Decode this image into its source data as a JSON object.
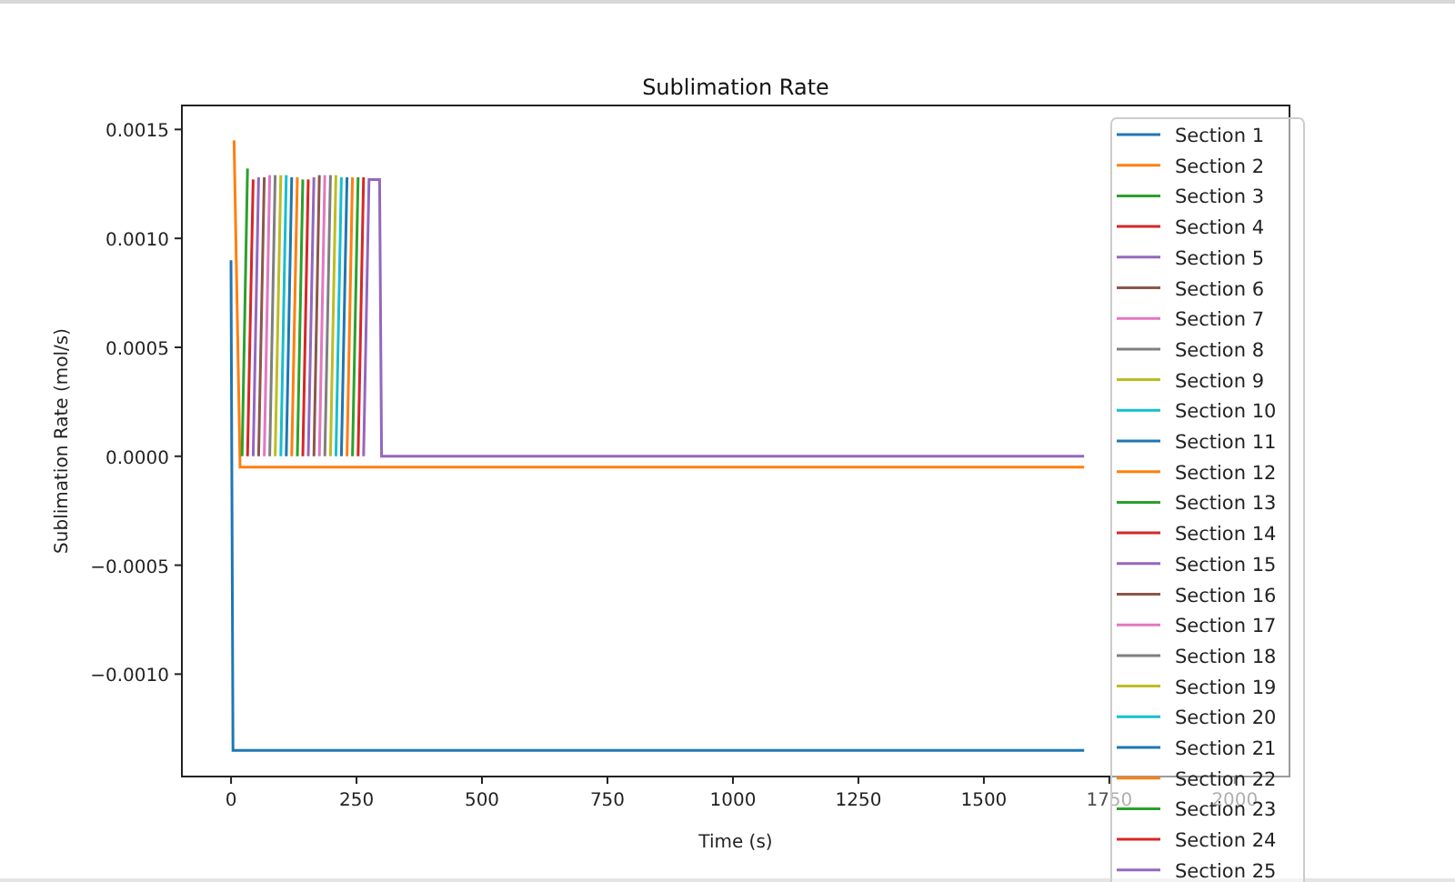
{
  "chart": {
    "chart_data": {
      "type": "line",
      "title": "Sublimation Rate",
      "xlabel": "Time (s)",
      "ylabel": "Sublimation Rate (mol/s)",
      "legend": "right",
      "xlim": [
        -98,
        2109
      ],
      "ylim": [
        -0.00147,
        0.00161
      ],
      "xticks": [
        0,
        250,
        500,
        750,
        1000,
        1250,
        1500,
        1750,
        2000
      ],
      "yticks": [
        {
          "value": 0.0015,
          "label": "0.0015"
        },
        {
          "value": 0.001,
          "label": "0.0010"
        },
        {
          "value": 0.0005,
          "label": "0.0005"
        },
        {
          "value": 0,
          "label": "0.0000"
        },
        {
          "value": -0.0005,
          "label": "−0.0005"
        },
        {
          "value": -0.001,
          "label": "−0.0010"
        }
      ],
      "x": [
        0,
        4,
        6,
        18,
        22,
        33,
        44,
        55,
        66,
        77,
        88,
        99,
        110,
        121,
        132,
        143,
        154,
        165,
        176,
        187,
        198,
        209,
        220,
        231,
        242,
        253,
        264,
        275,
        296,
        300,
        1700
      ],
      "series": [
        {
          "name": "Section 1",
          "color": "#1f77b4",
          "values": [
            0.0009,
            -0.00135,
            -0.00135,
            -0.00135,
            -0.00135,
            -0.00135,
            -0.00135,
            -0.00135,
            -0.00135,
            -0.00135,
            -0.00135,
            -0.00135,
            -0.00135,
            -0.00135,
            -0.00135,
            -0.00135,
            -0.00135,
            -0.00135,
            -0.00135,
            -0.00135,
            -0.00135,
            -0.00135,
            -0.00135,
            -0.00135,
            -0.00135,
            -0.00135,
            -0.00135,
            -0.00135,
            -0.00135,
            -0.00135,
            -0.00135
          ]
        },
        {
          "name": "Section 2",
          "color": "#ff7f0e",
          "values": [
            null,
            null,
            0.00145,
            -5e-05,
            -5e-05,
            -5e-05,
            -5e-05,
            -5e-05,
            -5e-05,
            -5e-05,
            -5e-05,
            -5e-05,
            -5e-05,
            -5e-05,
            -5e-05,
            -5e-05,
            -5e-05,
            -5e-05,
            -5e-05,
            -5e-05,
            -5e-05,
            -5e-05,
            -5e-05,
            -5e-05,
            -5e-05,
            -5e-05,
            -5e-05,
            -5e-05,
            -5e-05,
            -5e-05,
            -5e-05
          ]
        },
        {
          "name": "Section 3",
          "color": "#2ca02c",
          "values": [
            null,
            null,
            null,
            null,
            0,
            0.00132,
            null,
            null,
            null,
            null,
            null,
            null,
            null,
            null,
            null,
            null,
            null,
            null,
            null,
            null,
            null,
            null,
            null,
            null,
            null,
            null,
            null,
            null,
            null,
            null,
            null
          ]
        },
        {
          "name": "Section 4",
          "color": "#d62728",
          "values": [
            null,
            null,
            null,
            null,
            null,
            0,
            0.00127,
            null,
            null,
            null,
            null,
            null,
            null,
            null,
            null,
            null,
            null,
            null,
            null,
            null,
            null,
            null,
            null,
            null,
            null,
            null,
            null,
            null,
            null,
            null,
            null
          ]
        },
        {
          "name": "Section 5",
          "color": "#9467bd",
          "values": [
            null,
            null,
            null,
            null,
            null,
            null,
            0,
            0.00128,
            null,
            null,
            null,
            null,
            null,
            null,
            null,
            null,
            null,
            null,
            null,
            null,
            null,
            null,
            null,
            null,
            null,
            null,
            null,
            null,
            null,
            null,
            null
          ]
        },
        {
          "name": "Section 6",
          "color": "#8c564b",
          "values": [
            null,
            null,
            null,
            null,
            null,
            null,
            null,
            0,
            0.00128,
            null,
            null,
            null,
            null,
            null,
            null,
            null,
            null,
            null,
            null,
            null,
            null,
            null,
            null,
            null,
            null,
            null,
            null,
            null,
            null,
            null,
            null
          ]
        },
        {
          "name": "Section 7",
          "color": "#e377c2",
          "values": [
            null,
            null,
            null,
            null,
            null,
            null,
            null,
            null,
            0,
            0.00129,
            null,
            null,
            null,
            null,
            null,
            null,
            null,
            null,
            null,
            null,
            null,
            null,
            null,
            null,
            null,
            null,
            null,
            null,
            null,
            null,
            null
          ]
        },
        {
          "name": "Section 8",
          "color": "#7f7f7f",
          "values": [
            null,
            null,
            null,
            null,
            null,
            null,
            null,
            null,
            null,
            0,
            0.00129,
            null,
            null,
            null,
            null,
            null,
            null,
            null,
            null,
            null,
            null,
            null,
            null,
            null,
            null,
            null,
            null,
            null,
            null,
            null,
            null
          ]
        },
        {
          "name": "Section 9",
          "color": "#bcbd22",
          "values": [
            null,
            null,
            null,
            null,
            null,
            null,
            null,
            null,
            null,
            null,
            0,
            0.00129,
            null,
            null,
            null,
            null,
            null,
            null,
            null,
            null,
            null,
            null,
            null,
            null,
            null,
            null,
            null,
            null,
            null,
            null,
            null
          ]
        },
        {
          "name": "Section 10",
          "color": "#17becf",
          "values": [
            null,
            null,
            null,
            null,
            null,
            null,
            null,
            null,
            null,
            null,
            null,
            0,
            0.00129,
            null,
            null,
            null,
            null,
            null,
            null,
            null,
            null,
            null,
            null,
            null,
            null,
            null,
            null,
            null,
            null,
            null,
            null
          ]
        },
        {
          "name": "Section 11",
          "color": "#1f77b4",
          "values": [
            null,
            null,
            null,
            null,
            null,
            null,
            null,
            null,
            null,
            null,
            null,
            null,
            0,
            0.00128,
            null,
            null,
            null,
            null,
            null,
            null,
            null,
            null,
            null,
            null,
            null,
            null,
            null,
            null,
            null,
            null,
            null
          ]
        },
        {
          "name": "Section 12",
          "color": "#ff7f0e",
          "values": [
            null,
            null,
            null,
            null,
            null,
            null,
            null,
            null,
            null,
            null,
            null,
            null,
            null,
            0,
            0.00128,
            null,
            null,
            null,
            null,
            null,
            null,
            null,
            null,
            null,
            null,
            null,
            null,
            null,
            null,
            null,
            null
          ]
        },
        {
          "name": "Section 13",
          "color": "#2ca02c",
          "values": [
            null,
            null,
            null,
            null,
            null,
            null,
            null,
            null,
            null,
            null,
            null,
            null,
            null,
            null,
            0,
            0.00127,
            null,
            null,
            null,
            null,
            null,
            null,
            null,
            null,
            null,
            null,
            null,
            null,
            null,
            null,
            null
          ]
        },
        {
          "name": "Section 14",
          "color": "#d62728",
          "values": [
            null,
            null,
            null,
            null,
            null,
            null,
            null,
            null,
            null,
            null,
            null,
            null,
            null,
            null,
            null,
            0,
            0.00127,
            null,
            null,
            null,
            null,
            null,
            null,
            null,
            null,
            null,
            null,
            null,
            null,
            null,
            null
          ]
        },
        {
          "name": "Section 15",
          "color": "#9467bd",
          "values": [
            null,
            null,
            null,
            null,
            null,
            null,
            null,
            null,
            null,
            null,
            null,
            null,
            null,
            null,
            null,
            null,
            0,
            0.00128,
            null,
            null,
            null,
            null,
            null,
            null,
            null,
            null,
            null,
            null,
            null,
            null,
            null
          ]
        },
        {
          "name": "Section 16",
          "color": "#8c564b",
          "values": [
            null,
            null,
            null,
            null,
            null,
            null,
            null,
            null,
            null,
            null,
            null,
            null,
            null,
            null,
            null,
            null,
            null,
            0,
            0.00129,
            null,
            null,
            null,
            null,
            null,
            null,
            null,
            null,
            null,
            null,
            null,
            null
          ]
        },
        {
          "name": "Section 17",
          "color": "#e377c2",
          "values": [
            null,
            null,
            null,
            null,
            null,
            null,
            null,
            null,
            null,
            null,
            null,
            null,
            null,
            null,
            null,
            null,
            null,
            null,
            0,
            0.00129,
            null,
            null,
            null,
            null,
            null,
            null,
            null,
            null,
            null,
            null,
            null
          ]
        },
        {
          "name": "Section 18",
          "color": "#7f7f7f",
          "values": [
            null,
            null,
            null,
            null,
            null,
            null,
            null,
            null,
            null,
            null,
            null,
            null,
            null,
            null,
            null,
            null,
            null,
            null,
            null,
            0,
            0.00129,
            null,
            null,
            null,
            null,
            null,
            null,
            null,
            null,
            null,
            null
          ]
        },
        {
          "name": "Section 19",
          "color": "#bcbd22",
          "values": [
            null,
            null,
            null,
            null,
            null,
            null,
            null,
            null,
            null,
            null,
            null,
            null,
            null,
            null,
            null,
            null,
            null,
            null,
            null,
            null,
            0,
            0.00129,
            null,
            null,
            null,
            null,
            null,
            null,
            null,
            null,
            null
          ]
        },
        {
          "name": "Section 20",
          "color": "#17becf",
          "values": [
            null,
            null,
            null,
            null,
            null,
            null,
            null,
            null,
            null,
            null,
            null,
            null,
            null,
            null,
            null,
            null,
            null,
            null,
            null,
            null,
            null,
            0,
            0.00128,
            null,
            null,
            null,
            null,
            null,
            null,
            null,
            null
          ]
        },
        {
          "name": "Section 21",
          "color": "#1f77b4",
          "values": [
            null,
            null,
            null,
            null,
            null,
            null,
            null,
            null,
            null,
            null,
            null,
            null,
            null,
            null,
            null,
            null,
            null,
            null,
            null,
            null,
            null,
            null,
            0,
            0.00128,
            null,
            null,
            null,
            null,
            null,
            null,
            null
          ]
        },
        {
          "name": "Section 22",
          "color": "#ff7f0e",
          "values": [
            null,
            null,
            null,
            null,
            null,
            null,
            null,
            null,
            null,
            null,
            null,
            null,
            null,
            null,
            null,
            null,
            null,
            null,
            null,
            null,
            null,
            null,
            null,
            0,
            0.00128,
            null,
            null,
            null,
            null,
            null,
            null
          ]
        },
        {
          "name": "Section 23",
          "color": "#2ca02c",
          "values": [
            null,
            null,
            null,
            null,
            null,
            null,
            null,
            null,
            null,
            null,
            null,
            null,
            null,
            null,
            null,
            null,
            null,
            null,
            null,
            null,
            null,
            null,
            null,
            null,
            0,
            0.00128,
            null,
            null,
            null,
            null,
            null
          ]
        },
        {
          "name": "Section 24",
          "color": "#d62728",
          "values": [
            null,
            null,
            null,
            null,
            null,
            null,
            null,
            null,
            null,
            null,
            null,
            null,
            null,
            null,
            null,
            null,
            null,
            null,
            null,
            null,
            null,
            null,
            null,
            null,
            null,
            0,
            0.00128,
            null,
            null,
            null,
            null
          ]
        },
        {
          "name": "Section 25",
          "color": "#9467bd",
          "values": [
            null,
            null,
            null,
            null,
            null,
            null,
            null,
            null,
            null,
            null,
            null,
            null,
            null,
            null,
            null,
            null,
            null,
            null,
            null,
            null,
            null,
            null,
            null,
            null,
            null,
            null,
            0,
            0.00127,
            0.00127,
            0,
            0
          ]
        }
      ]
    }
  }
}
